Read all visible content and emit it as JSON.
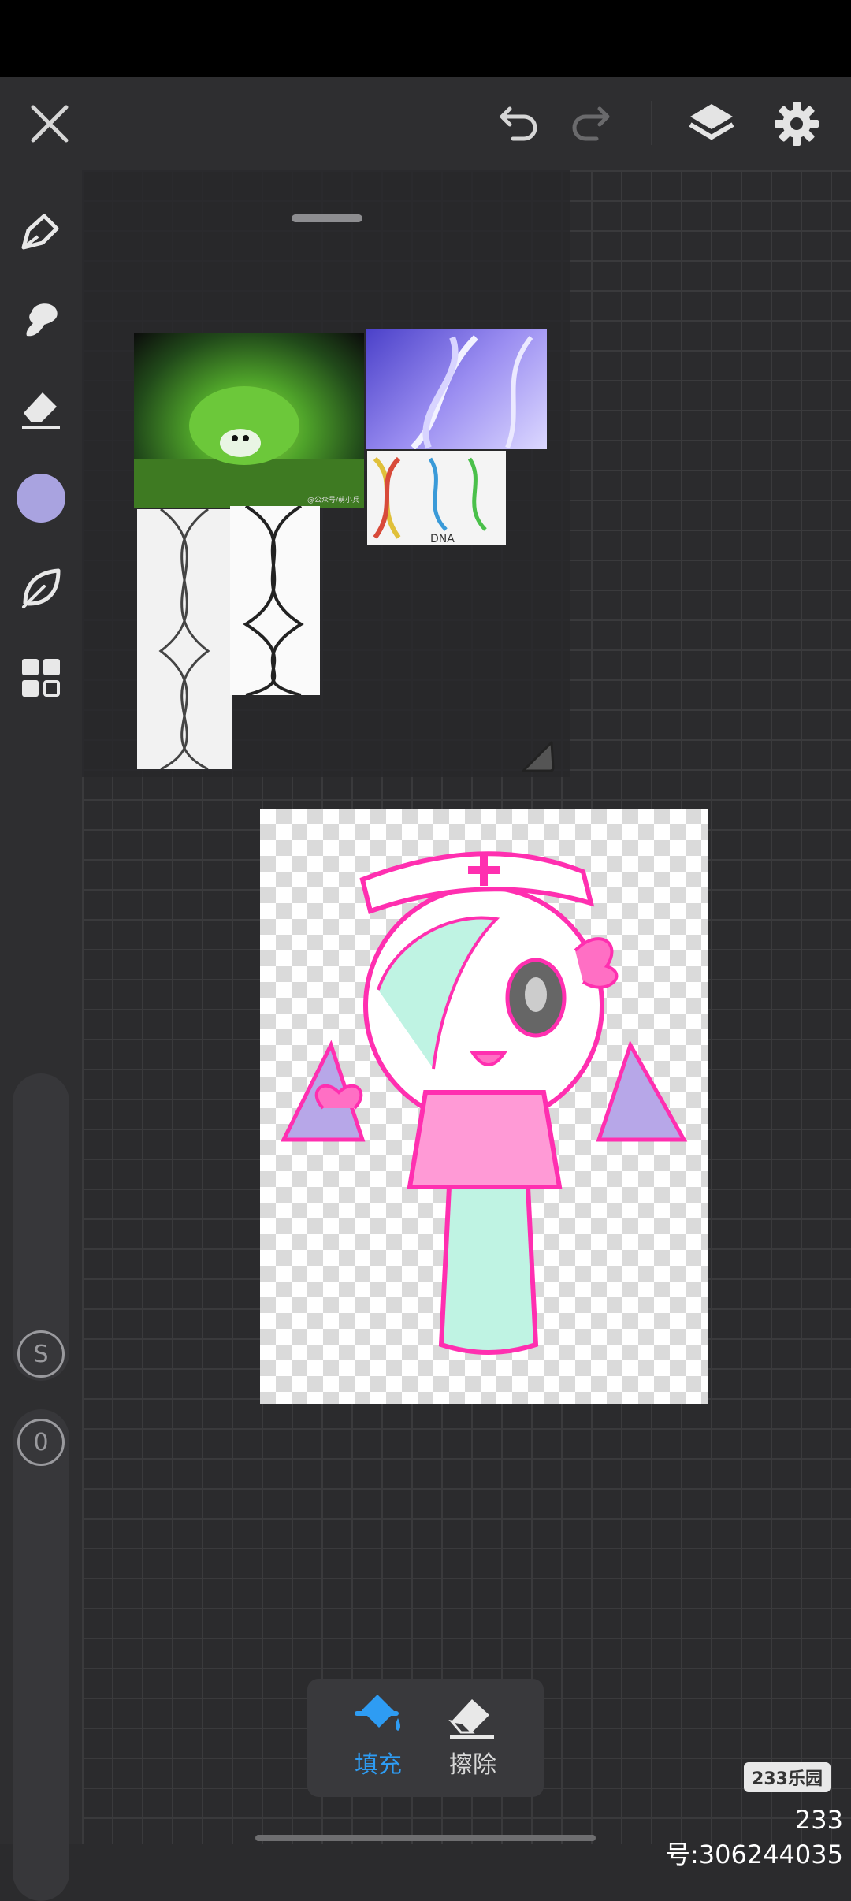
{
  "toolbar": {
    "tools": [
      {
        "name": "brush"
      },
      {
        "name": "smudge"
      },
      {
        "name": "eraser"
      },
      {
        "name": "color",
        "value": "#a9a3e0"
      },
      {
        "name": "leaf"
      },
      {
        "name": "grid"
      }
    ]
  },
  "references": {
    "sheep_caption": "@公众号/萌小兵"
  },
  "dna_label": "DNA",
  "sliders": {
    "size_label": "S",
    "opacity_label": "0"
  },
  "bottom_panel": {
    "fill_label": "填充",
    "erase_label": "擦除",
    "active_color": "#2e9cf3"
  },
  "watermark": {
    "logo_text": "233乐园",
    "id_text": "233号:306244035"
  }
}
